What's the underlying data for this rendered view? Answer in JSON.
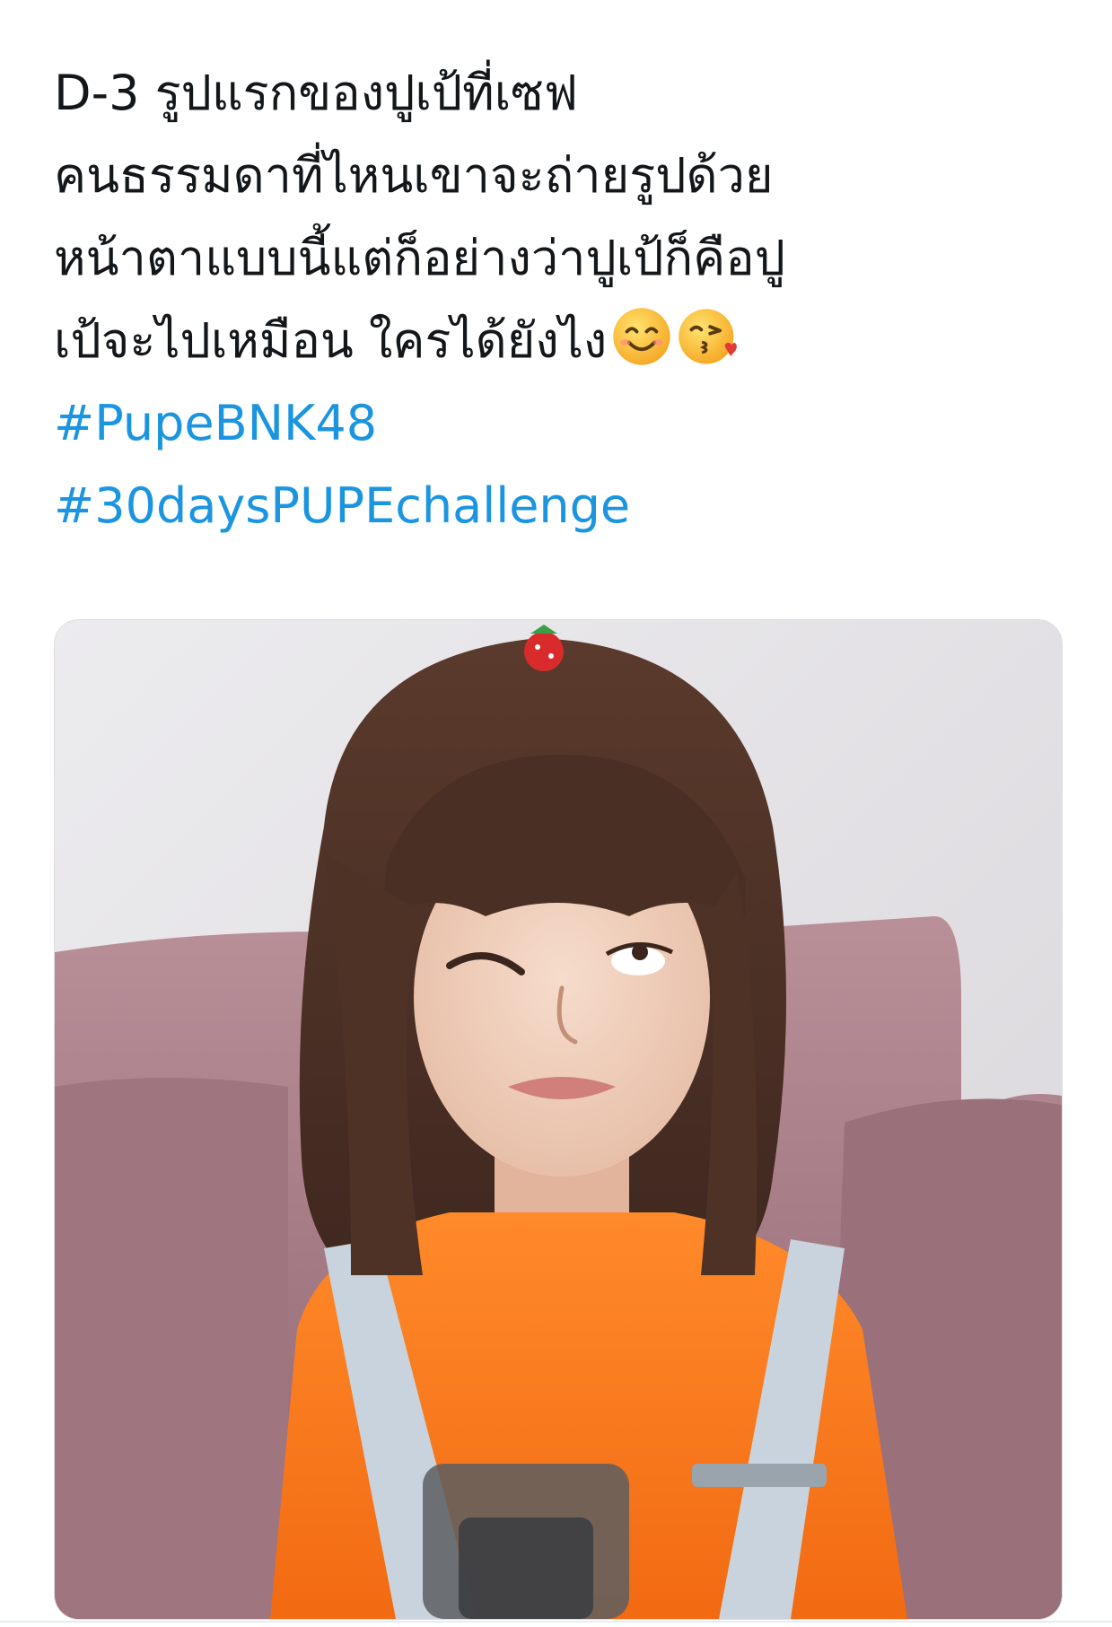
{
  "tweet": {
    "lines": [
      "D-3 รูปแรกของปูเป้ที่เซฟ",
      "คนธรรมดาที่ไหนเขาจะถ่ายรูปด้วย",
      "หน้าตาแบบนี้แต่ก็อย่างว่าปูเป้ก็คือปู",
      "เป้จะไปเหมือน ใครได้ยังไง"
    ],
    "emojis": [
      "smiling-face-icon",
      "face-blowing-kiss-icon"
    ],
    "hashtags": [
      "#PupeBNK48",
      "#30daysPUPEchallenge"
    ]
  },
  "colors": {
    "text": "#14171a",
    "link": "#1b95e0",
    "background": "#ffffff"
  }
}
